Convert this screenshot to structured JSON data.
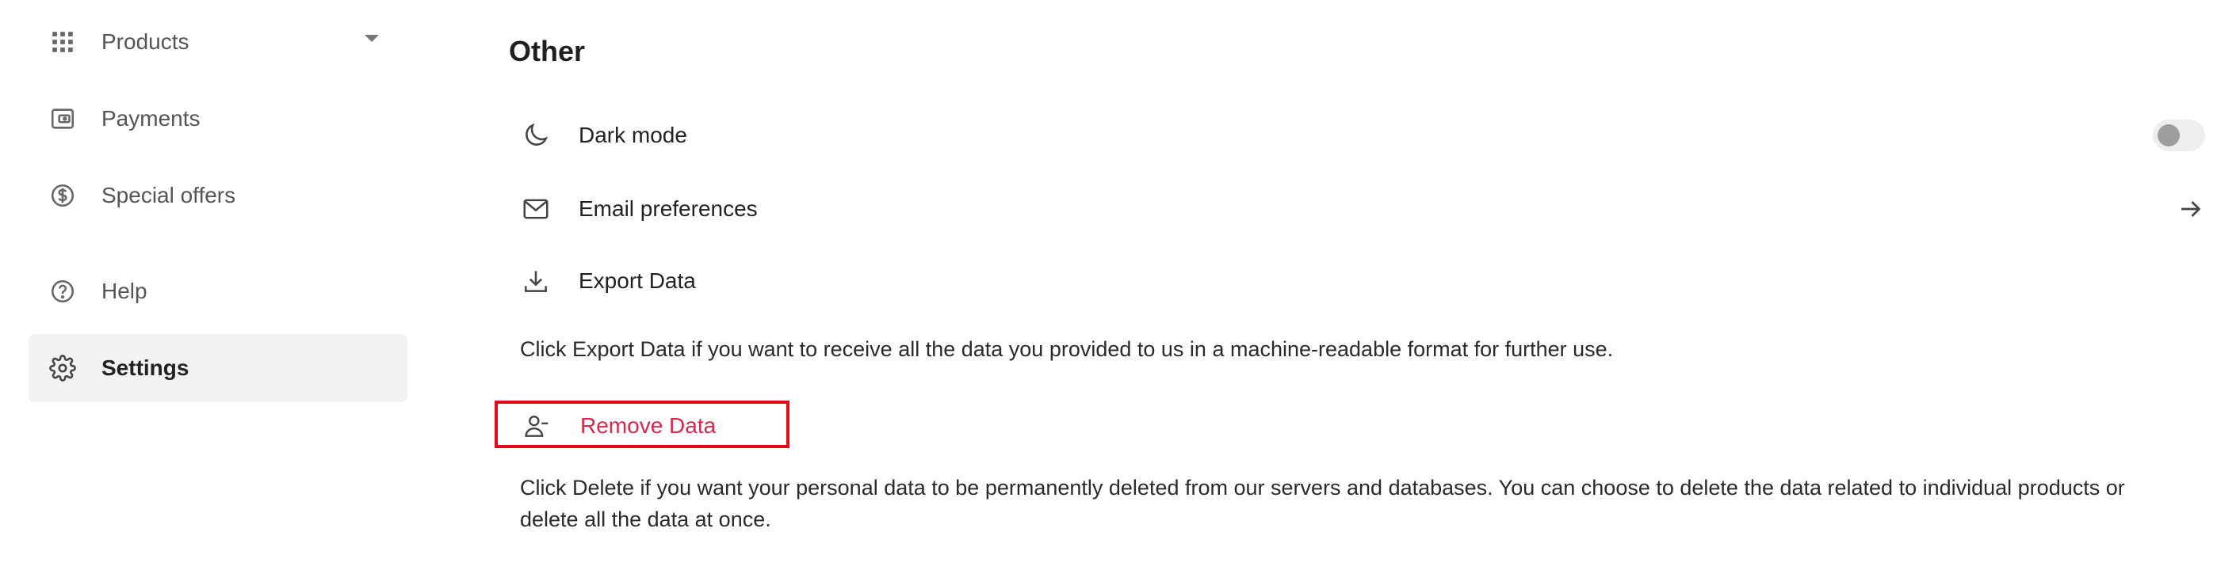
{
  "sidebar": {
    "items": [
      {
        "label": "Products",
        "icon": "grid-icon"
      },
      {
        "label": "Payments",
        "icon": "wallet-icon"
      },
      {
        "label": "Special offers",
        "icon": "dollar-circle-icon"
      },
      {
        "label": "Help",
        "icon": "help-circle-icon"
      },
      {
        "label": "Settings",
        "icon": "gear-icon",
        "active": true
      }
    ]
  },
  "main": {
    "section_title": "Other",
    "rows": {
      "dark_mode": {
        "label": "Dark mode",
        "icon": "moon-icon",
        "toggle_on": false
      },
      "email_preferences": {
        "label": "Email preferences",
        "icon": "mail-icon"
      },
      "export_data": {
        "label": "Export Data",
        "icon": "download-icon"
      },
      "remove_data": {
        "label": "Remove Data",
        "icon": "user-minus-icon"
      }
    },
    "export_description": "Click Export Data if you want to receive all the data you provided to us in a machine-readable format for further use.",
    "remove_description_line1": "Click Delete if you want your personal data to be permanently deleted from our servers and databases. You can choose to delete the data related to individual products or",
    "remove_description_line2": "delete all the data at once."
  },
  "colors": {
    "danger": "#d6294e",
    "highlight_border": "#e10a17",
    "active_bg": "#f3f3f3"
  }
}
